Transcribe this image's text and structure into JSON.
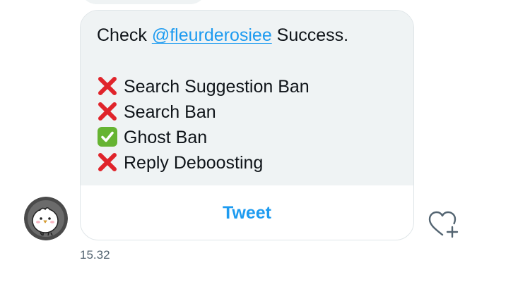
{
  "card": {
    "check_prefix": "Check ",
    "mention": "@fleurderosiee",
    "check_suffix": " Success.",
    "results": [
      {
        "label": "Search Suggestion Ban",
        "status": "fail",
        "icon": "cross-mark-icon"
      },
      {
        "label": "Search Ban",
        "status": "fail",
        "icon": "cross-mark-icon"
      },
      {
        "label": "Ghost Ban",
        "status": "pass",
        "icon": "check-mark-icon"
      },
      {
        "label": "Reply Deboosting",
        "status": "fail",
        "icon": "cross-mark-icon"
      }
    ],
    "button_label": "Tweet"
  },
  "message": {
    "timestamp": "15.32",
    "avatar": "bird-avatar-icon",
    "react_icon": "heart-plus-icon"
  },
  "colors": {
    "accent": "#1d9bf0",
    "bubble": "#eff3f4",
    "fail": "#e0242b",
    "pass": "#66b432",
    "muted": "#536471"
  }
}
